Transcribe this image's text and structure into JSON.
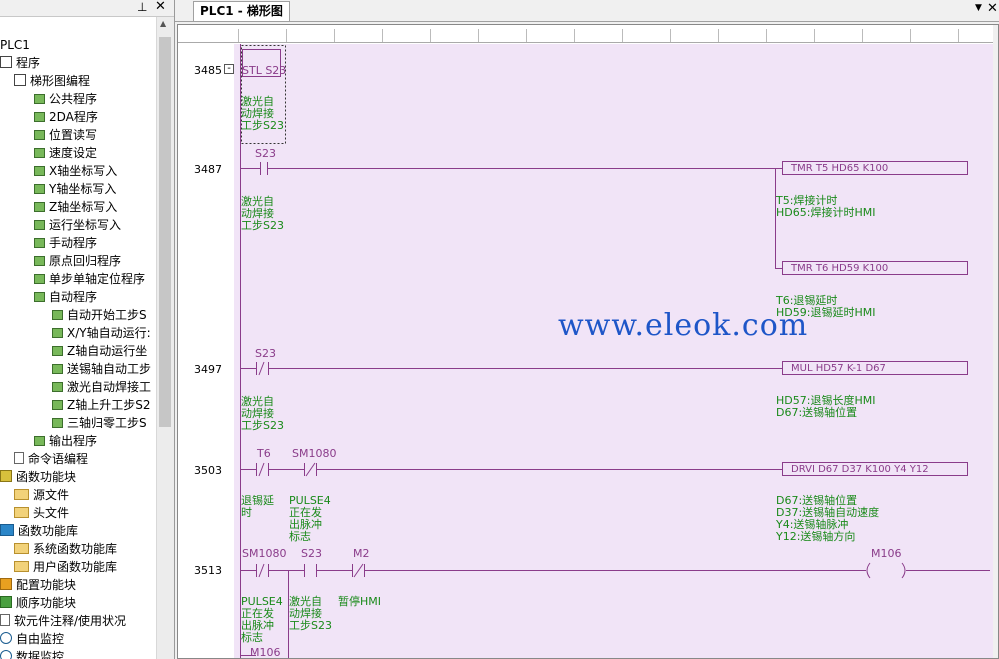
{
  "left_panel": {
    "pin_icon": "pin-icon",
    "close_icon": "close-icon",
    "tree": [
      {
        "label": "PLC1",
        "icon": "none",
        "depth": 0
      },
      {
        "label": "程序",
        "icon": "program-icon",
        "depth": 0
      },
      {
        "label": "梯形图编程",
        "icon": "ladder-icon",
        "depth": 1
      },
      {
        "label": "公共程序",
        "icon": "subprogram-icon",
        "depth": 2
      },
      {
        "label": "2DA程序",
        "icon": "subprogram-icon",
        "depth": 2
      },
      {
        "label": "位置读写",
        "icon": "subprogram-icon",
        "depth": 2
      },
      {
        "label": "速度设定",
        "icon": "subprogram-icon",
        "depth": 2
      },
      {
        "label": "X轴坐标写入",
        "icon": "subprogram-icon",
        "depth": 2
      },
      {
        "label": "Y轴坐标写入",
        "icon": "subprogram-icon",
        "depth": 2
      },
      {
        "label": "Z轴坐标写入",
        "icon": "subprogram-icon",
        "depth": 2
      },
      {
        "label": "运行坐标写入",
        "icon": "subprogram-icon",
        "depth": 2
      },
      {
        "label": "手动程序",
        "icon": "subprogram-icon",
        "depth": 2
      },
      {
        "label": "原点回归程序",
        "icon": "subprogram-icon",
        "depth": 2
      },
      {
        "label": "单步单轴定位程序",
        "icon": "subprogram-icon",
        "depth": 2
      },
      {
        "label": "自动程序",
        "icon": "subprogram-icon",
        "depth": 2
      },
      {
        "label": "自动开始工步S",
        "icon": "subprogram-icon",
        "depth": 3
      },
      {
        "label": "X/Y轴自动运行:",
        "icon": "subprogram-icon",
        "depth": 3
      },
      {
        "label": "Z轴自动运行坐",
        "icon": "subprogram-icon",
        "depth": 3
      },
      {
        "label": "送锡轴自动工步",
        "icon": "subprogram-icon",
        "depth": 3
      },
      {
        "label": "激光自动焊接工",
        "icon": "subprogram-icon",
        "depth": 3
      },
      {
        "label": "Z轴上升工步S2",
        "icon": "subprogram-icon",
        "depth": 3
      },
      {
        "label": "三轴归零工步S",
        "icon": "subprogram-icon",
        "depth": 3
      },
      {
        "label": "输出程序",
        "icon": "subprogram-icon",
        "depth": 2
      },
      {
        "label": "命令语编程",
        "icon": "command-icon",
        "depth": 1
      },
      {
        "label": "函数功能块",
        "icon": "function-block-icon",
        "depth": 0
      },
      {
        "label": "源文件",
        "icon": "folder-icon",
        "depth": 1
      },
      {
        "label": "头文件",
        "icon": "folder-icon",
        "depth": 1
      },
      {
        "label": "函数功能库",
        "icon": "function-library-icon",
        "depth": 0
      },
      {
        "label": "系统函数功能库",
        "icon": "folder-icon",
        "depth": 1
      },
      {
        "label": "用户函数功能库",
        "icon": "folder-icon",
        "depth": 1
      },
      {
        "label": "配置功能块",
        "icon": "config-icon",
        "depth": 0
      },
      {
        "label": "顺序功能块",
        "icon": "sfc-icon",
        "depth": 0
      },
      {
        "label": "软元件注释/使用状况",
        "icon": "document-icon",
        "depth": 0
      },
      {
        "label": "自由监控",
        "icon": "monitor-icon",
        "depth": 0
      },
      {
        "label": "数据监控",
        "icon": "monitor-icon",
        "depth": 0
      }
    ]
  },
  "tab": {
    "title": "PLC1 - 梯形图"
  },
  "ladder": {
    "steps": [
      "3485",
      "3487",
      "3497",
      "3503",
      "3513"
    ],
    "r1": {
      "stl": "STL S23",
      "comment": "激光自\n动焊接\n工步S23"
    },
    "r2": {
      "contact": "S23",
      "comment": "激光自\n动焊接\n工步S23",
      "ins1": "TMR      T5       HD65     K100",
      "ins1_cmt": "T5:焊接计时\nHD65:焊接计时HMI",
      "ins2": "TMR      T6       HD59     K100",
      "ins2_cmt": "T6:退锡延时\nHD59:退锡延时HMI"
    },
    "r3": {
      "contact": "S23",
      "comment": "激光自\n动焊接\n工步S23",
      "ins": "MUL      HD57     K-1        D67",
      "ins_cmt": "HD57:退锡长度HMI\nD67:送锡轴位置"
    },
    "r4": {
      "c1": "T6",
      "c2": "SM1080",
      "c1_cmt": "退锡延\n时",
      "c2_cmt": "PULSE4\n正在发\n出脉冲\n标志",
      "ins": "DRVI D67 D37 K100 Y4 Y12",
      "ins_cmt": "D67:送锡轴位置\nD37:送锡轴自动速度\nY4:送锡轴脉冲\nY12:送锡轴方向"
    },
    "r5": {
      "c1": "SM1080",
      "c2": "S23",
      "c3": "M2",
      "coil": "M106",
      "c1_cmt": "PULSE4\n正在发\n出脉冲\n标志",
      "c2_cmt": "激光自\n动焊接\n工步S23",
      "c3_cmt": "暂停HMI",
      "next": "M106"
    }
  },
  "watermark": "www.eleok.com"
}
